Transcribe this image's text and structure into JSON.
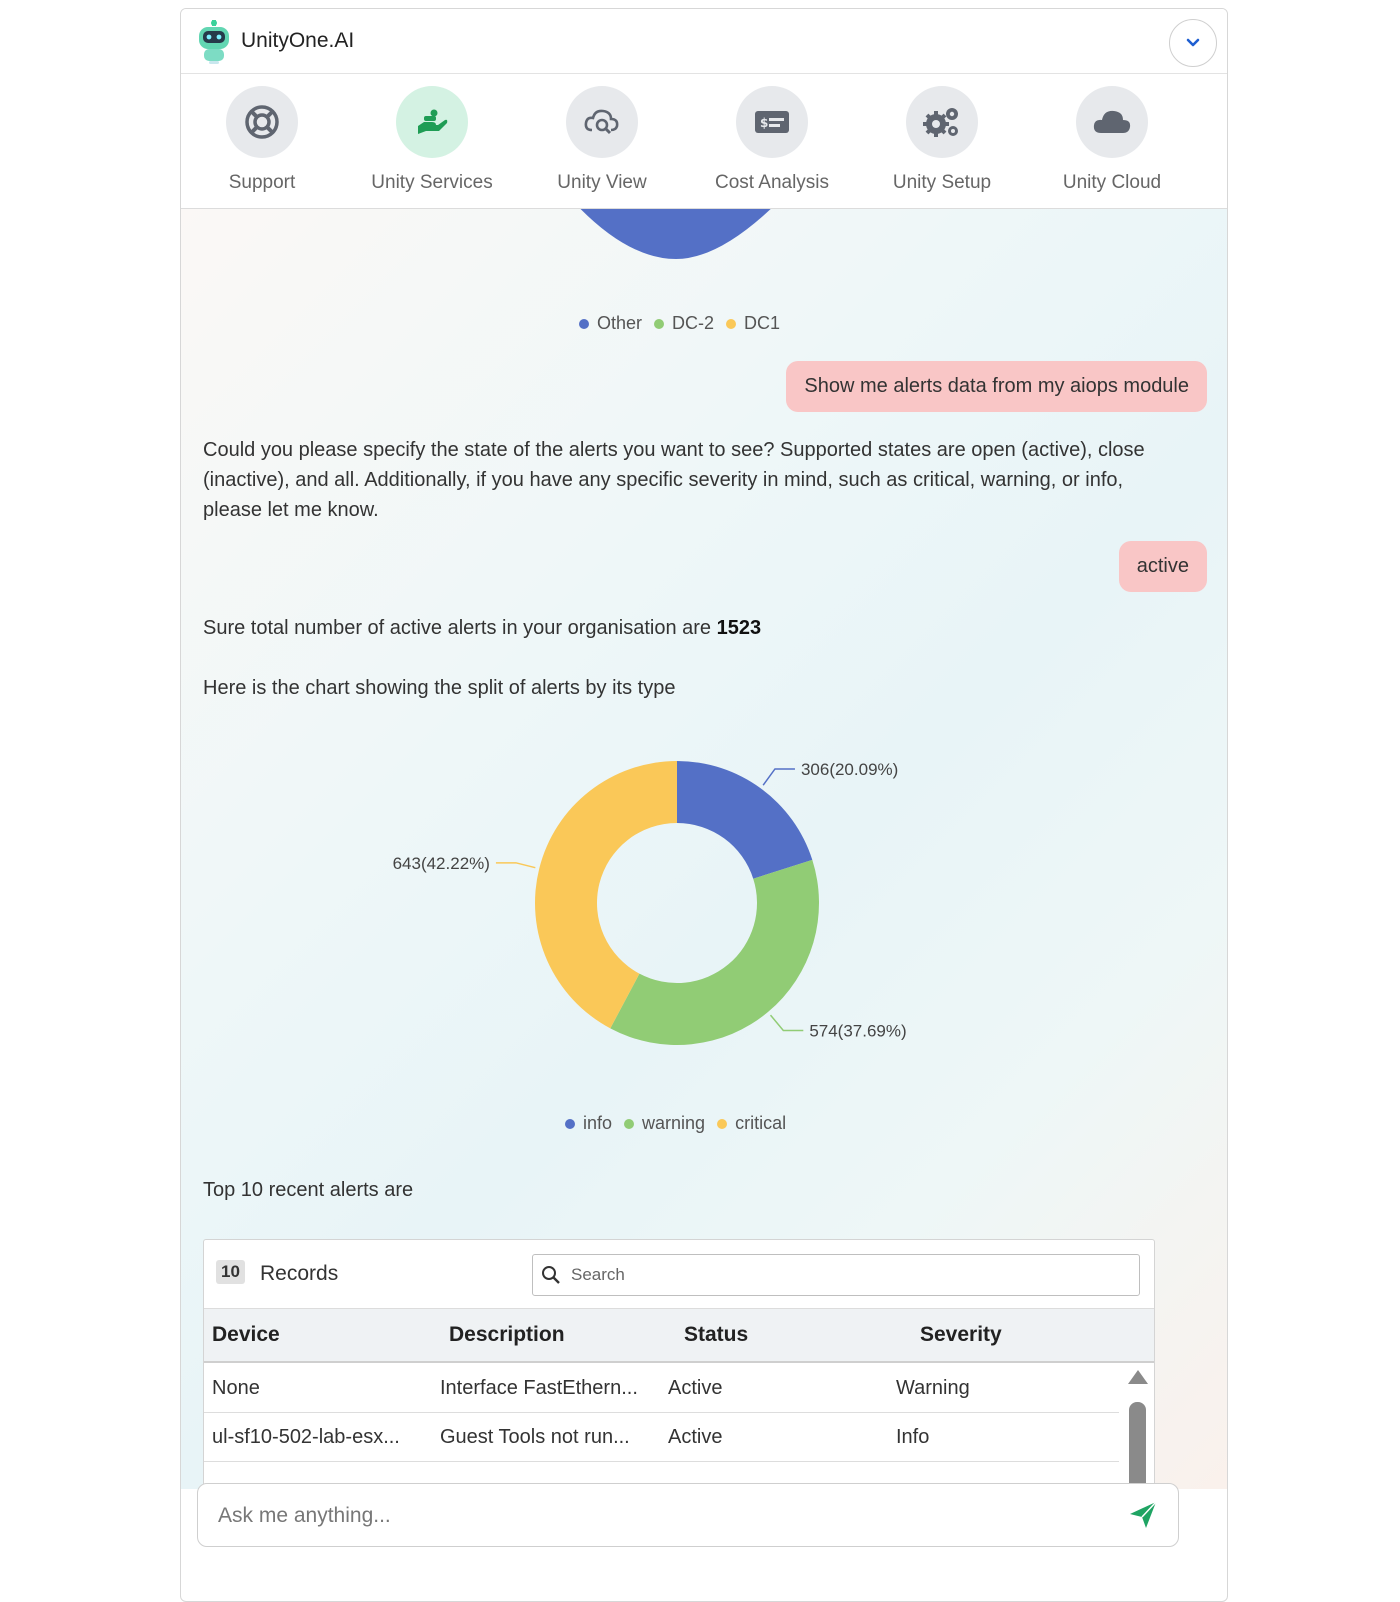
{
  "header": {
    "title": "UnityOne.AI"
  },
  "nav": {
    "items": [
      {
        "label": "Support",
        "icon": "lifebuoy-icon"
      },
      {
        "label": "Unity Services",
        "icon": "hand-service-icon",
        "active": true
      },
      {
        "label": "Unity View",
        "icon": "cloud-search-icon"
      },
      {
        "label": "Cost Analysis",
        "icon": "money-bill-icon"
      },
      {
        "label": "Unity Setup",
        "icon": "gears-icon"
      },
      {
        "label": "Unity Cloud",
        "icon": "cloud-icon"
      }
    ]
  },
  "colors": {
    "info": "#5470c6",
    "warning": "#91cc75",
    "critical": "#fac858",
    "user_bubble": "#f9c6c6",
    "accent_active": "#d4f2e3",
    "send": "#1fa463"
  },
  "prev_legend": [
    "Other",
    "DC-2",
    "DC1"
  ],
  "messages": {
    "user1": "Show me alerts data from my aiops module",
    "bot1": "Could you please specify the state of the alerts you want to see? Supported states are open (active), close (inactive), and all. Additionally, if you have any specific severity in mind, such as critical, warning, or info, please let me know.",
    "user2": "active",
    "bot2_prefix": "Sure total number of active alerts in your organisation are",
    "bot2_count": "1523",
    "bot3": "Here is the chart showing the split of alerts by its type",
    "bot4": "Top 10 recent alerts are"
  },
  "chart_data": {
    "type": "pie",
    "categories": [
      "info",
      "warning",
      "critical"
    ],
    "values": [
      306,
      574,
      643
    ],
    "data_labels": [
      "306(20.09%)",
      "574(37.69%)",
      "643(42.22%)"
    ],
    "legend_position": "bottom",
    "donut": true
  },
  "table": {
    "records_count": "10",
    "records_label": "Records",
    "search_placeholder": "Search",
    "columns": [
      "Device",
      "Description",
      "Status",
      "Severity"
    ],
    "rows": [
      [
        "None",
        "Interface FastEthern...",
        "Active",
        "Warning"
      ],
      [
        "ul-sf10-502-lab-esx...",
        "Guest Tools not run...",
        "Active",
        "Info"
      ]
    ]
  },
  "composer": {
    "placeholder": "Ask me anything..."
  }
}
